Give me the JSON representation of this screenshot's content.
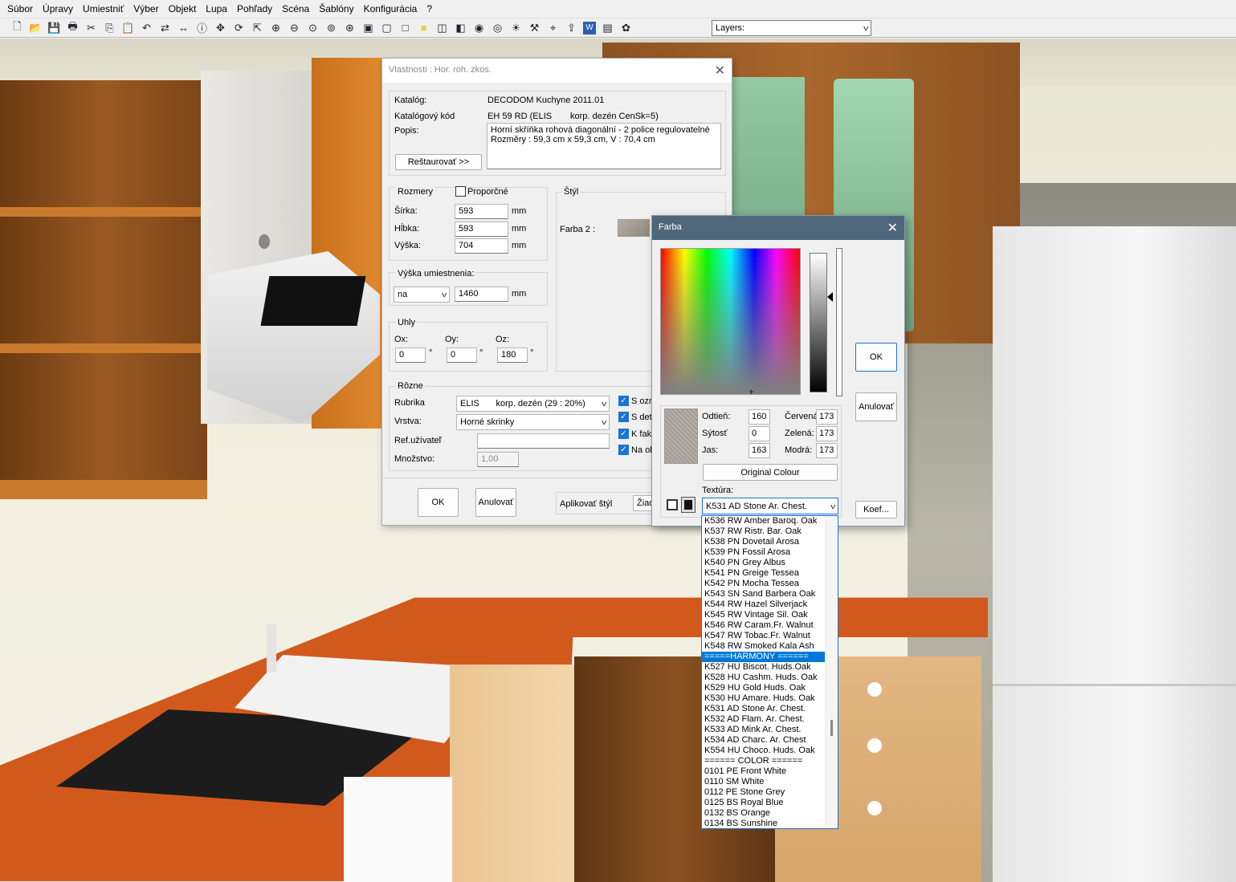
{
  "menu": [
    "Súbor",
    "Úpravy",
    "Umiestniť",
    "Výber",
    "Objekt",
    "Lupa",
    "Pohľady",
    "Scéna",
    "Šablóny",
    "Konfigurácia",
    "?"
  ],
  "toolbar": {
    "icons": [
      "new-icon",
      "open-icon",
      "save-icon",
      "print-icon",
      "cut-icon",
      "copy-icon",
      "paste-icon",
      "undo-icon",
      "move-icon",
      "dimension-icon",
      "info-icon",
      "pan-icon",
      "rotate-icon",
      "scale-icon",
      "zoom-in-icon",
      "zoom-out-icon",
      "zoom-window-icon",
      "zoom-all-icon",
      "zoom-extents-icon",
      "view-icon",
      "box-icon",
      "square-icon",
      "color-square-icon",
      "cube-icon",
      "cube2-icon",
      "camera-icon",
      "render-icon",
      "light-icon",
      "tools-icon",
      "measure-icon",
      "export-icon",
      "word-icon",
      "book-icon",
      "palette-icon"
    ],
    "layers_label": "Layers:"
  },
  "vlastnosti": {
    "title": "Vlastnosti : Hor. roh. zkos.",
    "katalog_label": "Katalóg:",
    "katalog_value": "DECODOM Kuchyne 2011.01",
    "kod_label": "Katalógový kód",
    "kod_value": "EH 59 RD (ELIS",
    "kod_extra": "korp. dezén CenSk=5)",
    "popis_label": "Popis:",
    "popis_line1": "Horní skříňka rohová diagonální - 2 police regulovatelné",
    "popis_line2": "Rozměry : 59,3 cm x 59,3 cm, V : 70,4 cm",
    "restore_btn": "Reštaurovať >>",
    "rozmery_label": "Rozmery",
    "proporcne_label": "Proporčné",
    "sirka_label": "Šírka:",
    "sirka_value": "593",
    "hlbka_label": "Hĺbka:",
    "hlbka_value": "593",
    "vyska_label": "Výška:",
    "vyska_value": "704",
    "mm": "mm",
    "vyska_umiest_label": "Výška umiestnenia:",
    "umiest_combo": "na",
    "umiest_value": "1460",
    "uhly_label": "Uhly",
    "ox_label": "Ox:",
    "ox_value": "0",
    "oy_label": "Oy:",
    "oy_value": "0",
    "oz_label": "Oz:",
    "oz_value": "180",
    "deg": "°",
    "styl_label": "Štýl",
    "farba2_label": "Farba 2 :",
    "rozne_label": "Rôzne",
    "rubrika_label": "Rubrika",
    "rubrika_value": "ELIS",
    "rubrika_extra": "korp. dezén (29 : 20%)",
    "vrstva_label": "Vrstva:",
    "vrstva_value": "Horné skrinky",
    "ref_label": "Ref.užívateľ",
    "mnozstvo_label": "Množstvo:",
    "mnozstvo_value": "1,00",
    "check1": "S ozn",
    "check2": "S det",
    "check3": "K fakt",
    "check4": "Na ob",
    "ok_btn": "OK",
    "cancel_btn": "Anulovať",
    "apply_style_label": "Aplikovať štýl",
    "apply_style_combo": "Žiad"
  },
  "farba": {
    "title": "Farba",
    "ok_btn": "OK",
    "cancel_btn": "Anulovať",
    "koef_btn": "Koef...",
    "odtien_label": "Odtieň:",
    "odtien_value": "160",
    "sytost_label": "Sýtosť",
    "sytost_value": "0",
    "jas_label": "Jas:",
    "jas_value": "163",
    "cervena_label": "Červená",
    "cervena_value": "173",
    "zelena_label": "Zelená:",
    "zelena_value": "173",
    "modra_label": "Modrá:",
    "modra_value": "173",
    "original_btn": "Original Colour",
    "textura_label": "Textúra:",
    "textura_value": "K531 AD Stone Ar. Chest."
  },
  "texture_list": {
    "selected_index": 13,
    "items": [
      "K536 RW Amber Baroq. Oak",
      "K537 RW Ristr. Bar. Oak",
      "K538 PN Dovetail Arosa",
      "K539 PN Fossil Arosa",
      "K540 PN Grey Albus",
      "K541 PN Greige Tessea",
      "K542 PN Mocha Tessea",
      "K543 SN Sand Barbera Oak",
      "K544 RW Hazel Silverjack",
      "K545 RW Vintage Sil. Oak",
      "K546 RW Caram.Fr. Walnut",
      "K547 RW Tobac.Fr. Walnut",
      "K548 RW Smoked Kala Ash",
      "=====HARMONY ======",
      "K527 HU Biscot. Huds.Oak",
      "K528 HU Cashm. Huds. Oak",
      "K529 HU Gold Huds. Oak",
      "K530 HU Amare. Huds. Oak",
      "K531 AD Stone Ar. Chest.",
      "K532 AD Flam. Ar. Chest.",
      "K533 AD Mink Ar. Chest.",
      "K534 AD Charc. Ar. Chest",
      "K554 HU Choco. Huds. Oak",
      "====== COLOR ======",
      "0101 PE Front White",
      "0110 SM White",
      "0112 PE Stone Grey",
      "0125 BS Royal Blue",
      "0132 BS Orange",
      "0134 BS Sunshine"
    ]
  },
  "colors": {
    "accent": "#0078d7",
    "farba_title_bar": "#4f677a",
    "countertop": "#d2591c",
    "wood": "#c9721f",
    "texture_grey": "#adadad"
  }
}
